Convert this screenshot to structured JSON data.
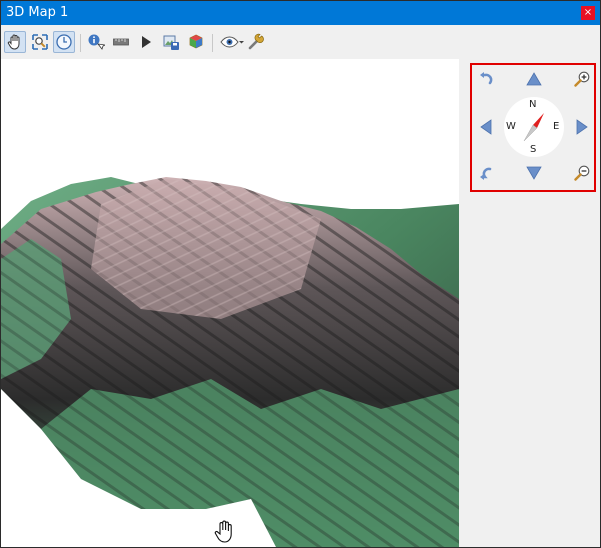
{
  "window": {
    "title": "3D Map 1",
    "close_glyph": "×"
  },
  "toolbar": {
    "buttons": [
      {
        "name": "pan-tool",
        "icon": "hand-icon",
        "active": true
      },
      {
        "name": "zoom-full",
        "icon": "zoom-full-icon",
        "active": false
      },
      {
        "name": "toggle-on-screen-navigation",
        "icon": "compass-icon",
        "active": true
      },
      {
        "name": "identify-tool",
        "icon": "identify-icon",
        "active": false
      },
      {
        "name": "measure-tool",
        "icon": "ruler-icon",
        "active": false
      },
      {
        "name": "animations",
        "icon": "play-icon",
        "active": false
      },
      {
        "name": "save-as-image",
        "icon": "save-image-icon",
        "active": false
      },
      {
        "name": "export-3d-scene",
        "icon": "cube-icon",
        "active": false
      },
      {
        "name": "camera-options",
        "icon": "eye-icon",
        "active": false
      },
      {
        "name": "configure",
        "icon": "wrench-icon",
        "active": false
      }
    ]
  },
  "navigation": {
    "compass": {
      "north": "N",
      "south": "S",
      "east": "E",
      "west": "W"
    },
    "colors": {
      "frame": "#e00000",
      "arrows": "#6a8fc9",
      "needle_north": "#e02020",
      "needle_south": "#c8c8c8"
    }
  },
  "colors": {
    "titlebar": "#0078d7",
    "terrain_green": "#5b9a72",
    "terrain_dark": "#3a3a3a",
    "terrain_pink": "#c9aeb0"
  }
}
